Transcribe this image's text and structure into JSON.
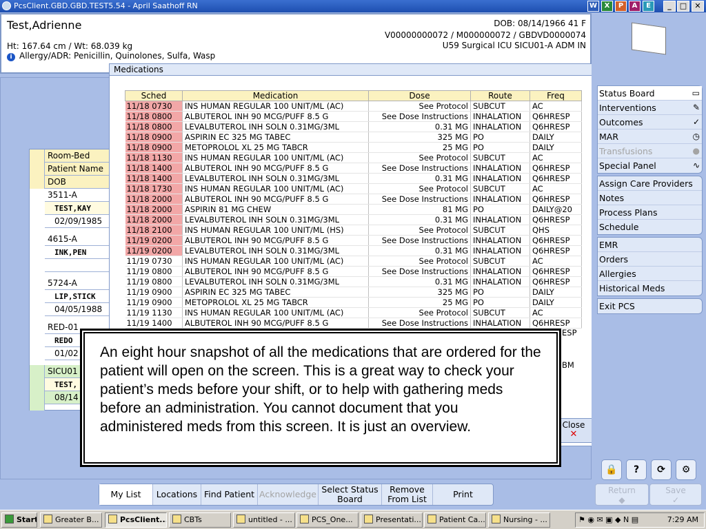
{
  "window": {
    "title": "PcsClient.GBD.GBD.TEST5.54 - April Saathoff RN",
    "office_icons": [
      "W",
      "X",
      "P",
      "A",
      "E"
    ],
    "minimize": "_",
    "maximize": "□",
    "close": "✕"
  },
  "patient": {
    "name": "Test,Adrienne",
    "ht_wt": "Ht: 167.64 cm / Wt: 68.039 kg",
    "allergy": "Allergy/ADR: Penicillin, Quinolones, Sulfa, Wasp",
    "dob": "DOB: 08/14/1966 41 F",
    "ids": "V00000000072 / M000000072 / GBDVD0000074",
    "location": "U59 Surgical ICU  SICU01-A  ADM IN"
  },
  "background_list": {
    "headers": [
      "Room-Bed",
      "Patient Name",
      "DOB"
    ],
    "rows": [
      {
        "room": "3511-A",
        "name": "TEST,KAY",
        "dob": "02/09/1985"
      },
      {
        "room": "4615-A",
        "name": "INK,PEN",
        "dob": ""
      },
      {
        "room": "5724-A",
        "name": "LIP,STICK",
        "dob": "04/05/1988"
      },
      {
        "room": "RED-01",
        "name": "REDO",
        "dob": "01/02"
      },
      {
        "room": "SICU01",
        "name": "TEST,",
        "dob": "08/14"
      }
    ]
  },
  "medications": {
    "title": "Medications",
    "columns": [
      "Sched",
      "Medication",
      "Dose",
      "Route",
      "Freq"
    ],
    "rows": [
      {
        "sched": "11/18 0730",
        "med": "INS HUMAN REGULAR 100 UNIT/ML (AC)",
        "dose": "See Protocol",
        "route": "SUBCUT",
        "freq": "AC",
        "past": true
      },
      {
        "sched": "11/18 0800",
        "med": "ALBUTEROL INH 90 MCG/PUFF 8.5 G",
        "dose": "See Dose Instructions",
        "route": "INHALATION",
        "freq": "Q6HRESP",
        "past": true
      },
      {
        "sched": "11/18 0800",
        "med": "LEVALBUTEROL INH SOLN 0.31MG/3ML",
        "dose": "0.31 MG",
        "route": "INHALATION",
        "freq": "Q6HRESP",
        "past": true
      },
      {
        "sched": "11/18 0900",
        "med": "ASPIRIN EC 325 MG TABEC",
        "dose": "325 MG",
        "route": "PO",
        "freq": "DAILY",
        "past": true
      },
      {
        "sched": "11/18 0900",
        "med": "METOPROLOL XL 25 MG TABCR",
        "dose": "25 MG",
        "route": "PO",
        "freq": "DAILY",
        "past": true
      },
      {
        "sched": "11/18 1130",
        "med": "INS HUMAN REGULAR 100 UNIT/ML (AC)",
        "dose": "See Protocol",
        "route": "SUBCUT",
        "freq": "AC",
        "past": true
      },
      {
        "sched": "11/18 1400",
        "med": "ALBUTEROL INH 90 MCG/PUFF 8.5 G",
        "dose": "See Dose Instructions",
        "route": "INHALATION",
        "freq": "Q6HRESP",
        "past": true
      },
      {
        "sched": "11/18 1400",
        "med": "LEVALBUTEROL INH SOLN 0.31MG/3ML",
        "dose": "0.31 MG",
        "route": "INHALATION",
        "freq": "Q6HRESP",
        "past": true
      },
      {
        "sched": "11/18 1730",
        "med": "INS HUMAN REGULAR 100 UNIT/ML (AC)",
        "dose": "See Protocol",
        "route": "SUBCUT",
        "freq": "AC",
        "past": true
      },
      {
        "sched": "11/18 2000",
        "med": "ALBUTEROL INH 90 MCG/PUFF 8.5 G",
        "dose": "See Dose Instructions",
        "route": "INHALATION",
        "freq": "Q6HRESP",
        "past": true
      },
      {
        "sched": "11/18 2000",
        "med": "ASPIRIN 81 MG CHEW",
        "dose": "81 MG",
        "route": "PO",
        "freq": "DAILY@20",
        "past": true
      },
      {
        "sched": "11/18 2000",
        "med": "LEVALBUTEROL INH SOLN 0.31MG/3ML",
        "dose": "0.31 MG",
        "route": "INHALATION",
        "freq": "Q6HRESP",
        "past": true
      },
      {
        "sched": "11/18 2100",
        "med": "INS HUMAN REGULAR 100 UNIT/ML (HS)",
        "dose": "See Protocol",
        "route": "SUBCUT",
        "freq": "QHS",
        "past": true
      },
      {
        "sched": "11/19 0200",
        "med": "ALBUTEROL INH 90 MCG/PUFF 8.5 G",
        "dose": "See Dose Instructions",
        "route": "INHALATION",
        "freq": "Q6HRESP",
        "past": true
      },
      {
        "sched": "11/19 0200",
        "med": "LEVALBUTEROL INH SOLN 0.31MG/3ML",
        "dose": "0.31 MG",
        "route": "INHALATION",
        "freq": "Q6HRESP",
        "past": true
      },
      {
        "sched": "11/19 0730",
        "med": "INS HUMAN REGULAR 100 UNIT/ML (AC)",
        "dose": "See Protocol",
        "route": "SUBCUT",
        "freq": "AC",
        "past": false
      },
      {
        "sched": "11/19 0800",
        "med": "ALBUTEROL INH 90 MCG/PUFF 8.5 G",
        "dose": "See Dose Instructions",
        "route": "INHALATION",
        "freq": "Q6HRESP",
        "past": false
      },
      {
        "sched": "11/19 0800",
        "med": "LEVALBUTEROL INH SOLN 0.31MG/3ML",
        "dose": "0.31 MG",
        "route": "INHALATION",
        "freq": "Q6HRESP",
        "past": false
      },
      {
        "sched": "11/19 0900",
        "med": "ASPIRIN EC 325 MG TABEC",
        "dose": "325 MG",
        "route": "PO",
        "freq": "DAILY",
        "past": false
      },
      {
        "sched": "11/19 0900",
        "med": "METOPROLOL XL 25 MG TABCR",
        "dose": "25 MG",
        "route": "PO",
        "freq": "DAILY",
        "past": false
      },
      {
        "sched": "11/19 1130",
        "med": "INS HUMAN REGULAR 100 UNIT/ML (AC)",
        "dose": "See Protocol",
        "route": "SUBCUT",
        "freq": "AC",
        "past": false
      },
      {
        "sched": "11/19 1400",
        "med": "ALBUTEROL INH 90 MCG/PUFF 8.5 G",
        "dose": "See Dose Instructions",
        "route": "INHALATION",
        "freq": "Q6HRESP",
        "past": false
      }
    ],
    "close_label": "Close",
    "close_icon": "✕",
    "peek_freq_right": [
      "ESP",
      "BM"
    ]
  },
  "callout": {
    "text": "An eight hour snapshot of all the medications that are ordered for the patient will open on the screen. This is a great way to check your patient’s meds before your shift, or to help with gathering meds before an administration. You cannot document that you administered meds from this screen. It is just an overview."
  },
  "right_panel": {
    "group1": [
      {
        "label": "Status Board",
        "icon": "book-icon",
        "glyph": "▭",
        "active": true,
        "disabled": false
      },
      {
        "label": "Interventions",
        "icon": "interventions-icon",
        "glyph": "✎",
        "active": false,
        "disabled": false
      },
      {
        "label": "Outcomes",
        "icon": "checklist-icon",
        "glyph": "✓",
        "active": false,
        "disabled": false
      },
      {
        "label": "MAR",
        "icon": "clock-icon",
        "glyph": "◷",
        "active": false,
        "disabled": false
      },
      {
        "label": "Transfusions",
        "icon": "blood-drop-icon",
        "glyph": "●",
        "active": false,
        "disabled": true
      },
      {
        "label": "Special Panel",
        "icon": "heartbeat-icon",
        "glyph": "∿",
        "active": false,
        "disabled": false
      }
    ],
    "group2": [
      "Assign Care Providers",
      "Notes",
      "Process Plans",
      "Schedule"
    ],
    "group3": [
      "EMR",
      "Orders",
      "Allergies",
      "Historical Meds"
    ],
    "group4": [
      "Exit PCS"
    ],
    "tool_buttons": [
      {
        "name": "lock-icon",
        "glyph": "🔒"
      },
      {
        "name": "help-icon",
        "glyph": "?"
      },
      {
        "name": "refresh-icon",
        "glyph": "⟳"
      },
      {
        "name": "settings-icon",
        "glyph": "⚙"
      }
    ],
    "return_label": "Return",
    "save_label": "Save"
  },
  "bottom_bar": {
    "buttons": [
      {
        "label": "My List",
        "active": true,
        "disabled": false
      },
      {
        "label": "Locations",
        "active": false,
        "disabled": false
      },
      {
        "label": "Find Patient",
        "active": false,
        "disabled": false
      },
      {
        "label": "Acknowledge",
        "active": false,
        "disabled": true
      },
      {
        "label": "Select Status Board",
        "active": false,
        "disabled": false
      },
      {
        "label": "Remove From List",
        "active": false,
        "disabled": false
      },
      {
        "label": "Print",
        "active": false,
        "disabled": false
      }
    ]
  },
  "taskbar": {
    "start": "Start",
    "tasks": [
      "Greater B...",
      "PcsClient...",
      "CBTs",
      "untitled - ...",
      "PCS_One...",
      "Presentati...",
      "Patient Ca...",
      "Nursing - ..."
    ],
    "clock": "7:29 AM"
  }
}
